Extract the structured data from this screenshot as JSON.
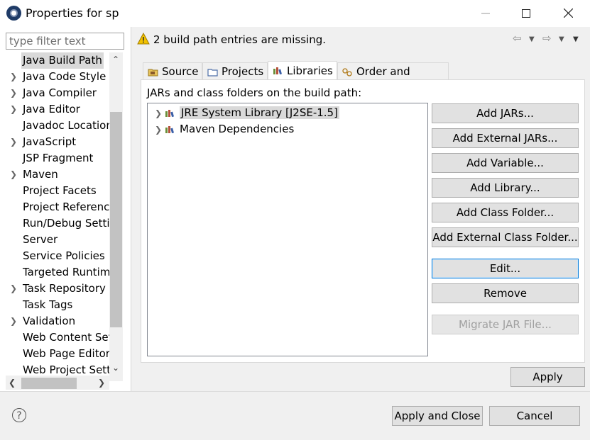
{
  "window": {
    "title": "Properties for sp"
  },
  "left_pane": {
    "filter_placeholder": "type filter text",
    "items": [
      {
        "label": "Java Build Path",
        "expandable": false,
        "selected": true
      },
      {
        "label": "Java Code Style",
        "expandable": true
      },
      {
        "label": "Java Compiler",
        "expandable": true
      },
      {
        "label": "Java Editor",
        "expandable": true
      },
      {
        "label": "Javadoc Location",
        "expandable": false
      },
      {
        "label": "JavaScript",
        "expandable": true
      },
      {
        "label": "JSP Fragment",
        "expandable": false
      },
      {
        "label": "Maven",
        "expandable": true
      },
      {
        "label": "Project Facets",
        "expandable": false
      },
      {
        "label": "Project References",
        "expandable": false
      },
      {
        "label": "Run/Debug Settings",
        "expandable": false
      },
      {
        "label": "Server",
        "expandable": false
      },
      {
        "label": "Service Policies",
        "expandable": false
      },
      {
        "label": "Targeted Runtimes",
        "expandable": false
      },
      {
        "label": "Task Repository",
        "expandable": true
      },
      {
        "label": "Task Tags",
        "expandable": false
      },
      {
        "label": "Validation",
        "expandable": true
      },
      {
        "label": "Web Content Settings",
        "expandable": false
      },
      {
        "label": "Web Page Editor",
        "expandable": false
      },
      {
        "label": "Web Project Settings",
        "expandable": false
      }
    ]
  },
  "header": {
    "message": "2 build path entries are missing."
  },
  "tabs": [
    {
      "label": "Source",
      "active": false
    },
    {
      "label": "Projects",
      "active": false
    },
    {
      "label": "Libraries",
      "active": true
    },
    {
      "label": "Order and Export",
      "active": false
    }
  ],
  "libraries": {
    "label": "JARs and class folders on the build path:",
    "entries": [
      {
        "label": "JRE System Library [J2SE-1.5]",
        "selected": true
      },
      {
        "label": "Maven Dependencies",
        "selected": false
      }
    ],
    "buttons": {
      "add_jars": "Add JARs...",
      "add_external_jars": "Add External JARs...",
      "add_variable": "Add Variable...",
      "add_library": "Add Library...",
      "add_class_folder": "Add Class Folder...",
      "add_external_class_folder": "Add External Class Folder...",
      "edit": "Edit...",
      "remove": "Remove",
      "migrate_jar": "Migrate JAR File..."
    }
  },
  "footer": {
    "apply": "Apply",
    "apply_and_close": "Apply and Close",
    "cancel": "Cancel"
  },
  "colors": {
    "accent": "#0078d7",
    "selection": "#d9d9d9",
    "warning": "#f2c200"
  }
}
